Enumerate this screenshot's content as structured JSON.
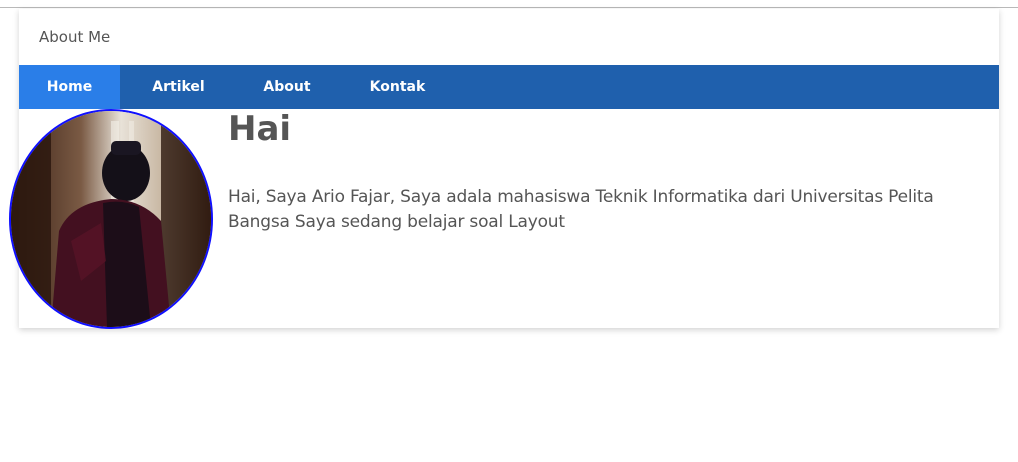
{
  "header": {
    "title": "About Me"
  },
  "nav": {
    "items": [
      {
        "label": "Home",
        "active": true
      },
      {
        "label": "Artikel",
        "active": false
      },
      {
        "label": "About",
        "active": false
      },
      {
        "label": "Kontak",
        "active": false
      }
    ]
  },
  "profile": {
    "image_alt_icon": "profile-photo",
    "heading": "Hai",
    "text": "Hai, Saya Ario Fajar, Saya adala mahasiswa Teknik Informatika dari Universitas Pelita Bangsa Saya sedang belajar soal Layout"
  },
  "colors": {
    "nav_bg": "#1f60ad",
    "nav_active": "#2a7ee8",
    "avatar_border": "#1010ff",
    "text": "#555555"
  }
}
